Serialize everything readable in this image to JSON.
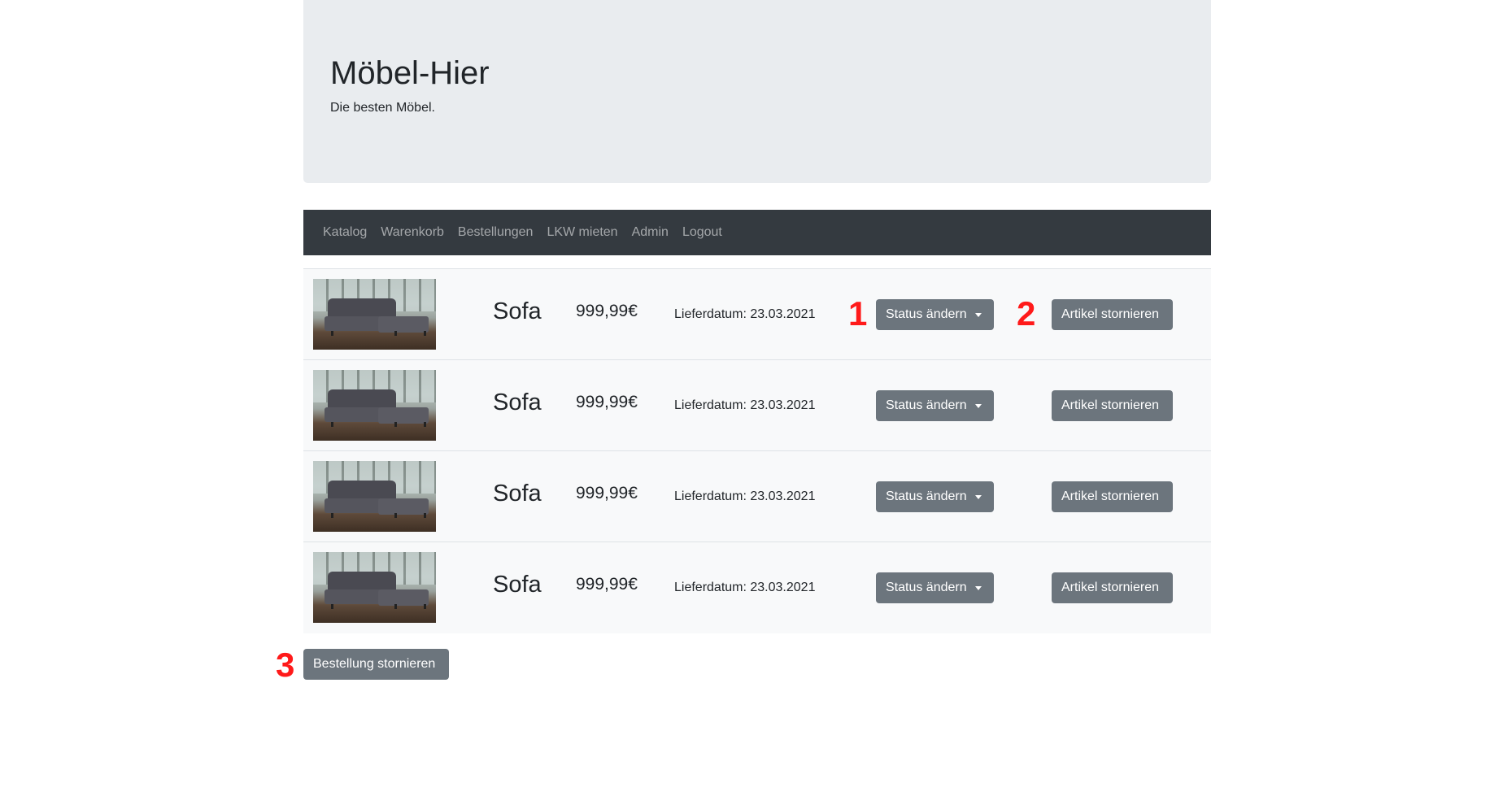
{
  "header": {
    "title": "Möbel-Hier",
    "subtitle": "Die besten Möbel."
  },
  "nav": {
    "items": [
      "Katalog",
      "Warenkorb",
      "Bestellungen",
      "LKW mieten",
      "Admin",
      "Logout"
    ]
  },
  "orders": [
    {
      "name": "Sofa",
      "price": "999,99€",
      "delivery": "Lieferdatum: 23.03.2021",
      "status_label": "Status ändern",
      "cancel_label": "Artikel stornieren"
    },
    {
      "name": "Sofa",
      "price": "999,99€",
      "delivery": "Lieferdatum: 23.03.2021",
      "status_label": "Status ändern",
      "cancel_label": "Artikel stornieren"
    },
    {
      "name": "Sofa",
      "price": "999,99€",
      "delivery": "Lieferdatum: 23.03.2021",
      "status_label": "Status ändern",
      "cancel_label": "Artikel stornieren"
    },
    {
      "name": "Sofa",
      "price": "999,99€",
      "delivery": "Lieferdatum: 23.03.2021",
      "status_label": "Status ändern",
      "cancel_label": "Artikel stornieren"
    }
  ],
  "cancel_order_label": "Bestellung stornieren",
  "markers": [
    "1",
    "2",
    "3"
  ],
  "colors": {
    "button": "#6c757d",
    "navbar": "#343a40",
    "jumbotron": "#e9ecef",
    "marker": "#ff1a1a"
  }
}
